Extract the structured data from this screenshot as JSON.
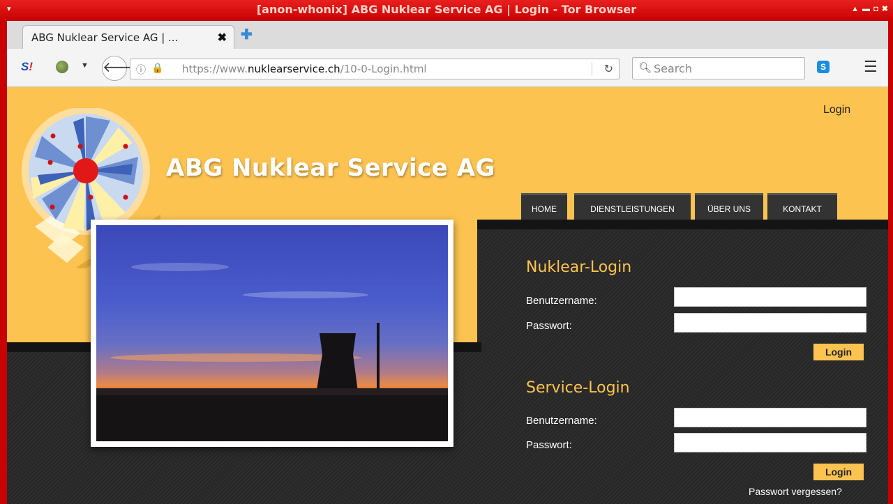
{
  "window": {
    "title": "[anon-whonix] ABG Nuklear Service AG | Login - Tor Browser",
    "menu_glyph": "▾",
    "controls": "▲ ▬ ◘ ✖"
  },
  "browser": {
    "tab_title": "ABG Nuklear Service AG | ...",
    "tab_close": "✖",
    "new_tab": "✚",
    "url_prefix": "https://www.",
    "url_domain": "nuklearservice.ch",
    "url_path": "/10-0-Login.html",
    "search_placeholder": "Search",
    "back_glyph": "🡐",
    "reload_glyph": "↻",
    "menu_glyph": "☰",
    "noscript_label": "S",
    "noscript_exclaim": "!",
    "skype_label": "S"
  },
  "site": {
    "brand": "ABG Nuklear Service AG",
    "top_login_link": "Login",
    "nav": [
      "HOME",
      "DIENSTLEISTUNGEN",
      "ÜBER UNS",
      "KONTAKT"
    ],
    "nuklear_login": {
      "heading": "Nuklear-Login",
      "username_label": "Benutzername:",
      "password_label": "Passwort:",
      "button": "Login"
    },
    "service_login": {
      "heading": "Service-Login",
      "username_label": "Benutzername:",
      "password_label": "Passwort:",
      "button": "Login"
    },
    "forgot_password": "Passwort vergessen?"
  },
  "colors": {
    "accent_yellow": "#fcc351",
    "titlebar_red": "#c90000",
    "dark_bg": "#2a2a2a"
  }
}
